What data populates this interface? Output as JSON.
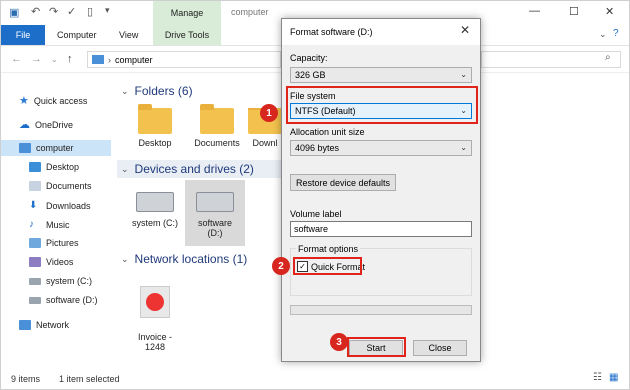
{
  "window": {
    "manage_tab": "Manage",
    "title": "computer",
    "ribbon_tabs": [
      "File",
      "Computer",
      "View",
      "Drive Tools"
    ],
    "address": "computer"
  },
  "sidebar": {
    "items": [
      {
        "label": "Quick access",
        "icon": "star-icon"
      },
      {
        "label": "OneDrive",
        "icon": "cloud-icon"
      },
      {
        "label": "computer",
        "icon": "computer-icon"
      },
      {
        "label": "Desktop",
        "icon": "desktop-icon"
      },
      {
        "label": "Documents",
        "icon": "documents-icon"
      },
      {
        "label": "Downloads",
        "icon": "downloads-icon"
      },
      {
        "label": "Music",
        "icon": "music-icon"
      },
      {
        "label": "Pictures",
        "icon": "pictures-icon"
      },
      {
        "label": "Videos",
        "icon": "videos-icon"
      },
      {
        "label": "system (C:)",
        "icon": "drive-icon"
      },
      {
        "label": "software (D:)",
        "icon": "drive-icon"
      },
      {
        "label": "Network",
        "icon": "network-icon"
      }
    ]
  },
  "content": {
    "folders_header": "Folders (6)",
    "folders": [
      "Desktop",
      "Documents",
      "Downl"
    ],
    "devices_header": "Devices and drives (2)",
    "drives": [
      "system (C:)",
      "software\n(D:)"
    ],
    "network_header": "Network locations (1)",
    "network_items": [
      "Invoice -\n1248"
    ]
  },
  "status": {
    "items": "9 items",
    "selected": "1 item selected"
  },
  "dialog": {
    "title": "Format software (D:)",
    "capacity_label": "Capacity:",
    "capacity_value": "326 GB",
    "filesystem_label": "File system",
    "filesystem_value": "NTFS (Default)",
    "alloc_label": "Allocation unit size",
    "alloc_value": "4096 bytes",
    "restore_label": "Restore device defaults",
    "volume_label": "Volume label",
    "volume_value": "software",
    "options_label": "Format options",
    "quick_format_label": "Quick Format",
    "quick_format_checked": true,
    "start_label": "Start",
    "close_label": "Close"
  },
  "badges": [
    "1",
    "2",
    "3"
  ],
  "colors": {
    "highlight": "#e0241c",
    "badge": "#d7261d",
    "file_tab": "#1c6ec9"
  }
}
